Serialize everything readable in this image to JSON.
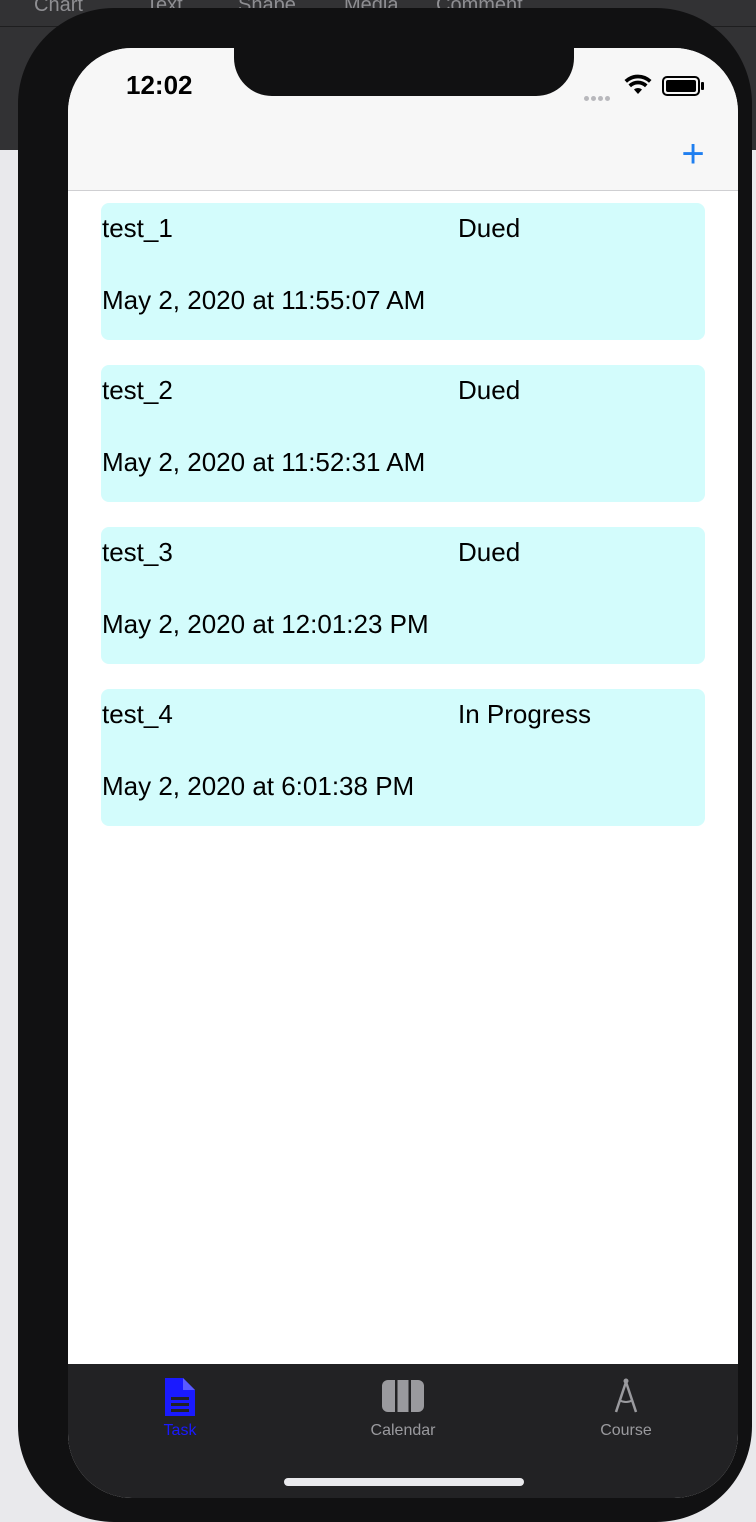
{
  "background_app": {
    "menu": [
      "Chart",
      "Text",
      "Shape",
      "Media",
      "Comment"
    ]
  },
  "status_bar": {
    "time": "12:02"
  },
  "nav_bar": {
    "add_icon": "plus-icon",
    "add_glyph": "+"
  },
  "tasks": [
    {
      "name": "test_1",
      "status": "Dued",
      "date": "May 2, 2020 at 11:55:07 AM"
    },
    {
      "name": "test_2",
      "status": "Dued",
      "date": "May 2, 2020 at 11:52:31 AM"
    },
    {
      "name": "test_3",
      "status": "Dued",
      "date": "May 2, 2020 at 12:01:23 PM"
    },
    {
      "name": "test_4",
      "status": "In Progress",
      "date": "May 2, 2020 at 6:01:38 PM"
    }
  ],
  "tab_bar": {
    "items": [
      {
        "label": "Task",
        "icon": "document-icon",
        "active": true
      },
      {
        "label": "Calendar",
        "icon": "calendar-columns-icon",
        "active": false
      },
      {
        "label": "Course",
        "icon": "compass-icon",
        "active": false
      }
    ]
  },
  "colors": {
    "accent": "#1f7ff0",
    "active_tab": "#1a1aff",
    "card_bg": "#d3fcfc",
    "tab_bar_bg": "#222224"
  }
}
